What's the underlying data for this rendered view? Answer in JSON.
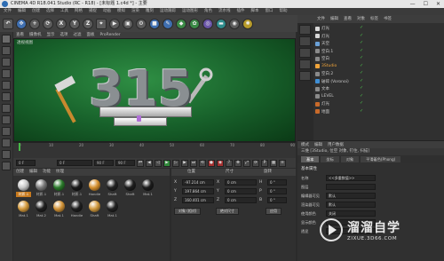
{
  "window": {
    "title": "CINEMA 4D R18.041 Studio (RC - R18) - [未标题 1.c4d *] - 主要"
  },
  "menubar": {
    "items": [
      "文件",
      "编辑",
      "创建",
      "选择",
      "工具",
      "网格",
      "捕捉",
      "动画",
      "模拟",
      "渲染",
      "雕刻",
      "运动跟踪",
      "运动图形",
      "角色",
      "流水线",
      "插件",
      "脚本",
      "窗口",
      "帮助"
    ]
  },
  "toolbar": {
    "buttons": [
      "undo-icon",
      "move-icon",
      "scale-icon",
      "rotate-icon",
      "x-axis",
      "y-axis",
      "z-axis",
      "coordinate-icon",
      "render-view-icon",
      "render-icon",
      "render-settings-icon",
      "cube-icon",
      "pen-icon",
      "subdivision-icon",
      "array-icon",
      "deformer-icon",
      "floor-icon",
      "camera-icon",
      "light-icon"
    ],
    "axis_labels": [
      "X",
      "Y",
      "Z"
    ]
  },
  "viewport": {
    "menu": [
      "查看",
      "摄像机",
      "显示",
      "选项",
      "过滤",
      "面板",
      "ProRender"
    ],
    "label": "透视视图",
    "numerals": "315"
  },
  "timeline": {
    "ticks": [
      "0",
      "10",
      "20",
      "30",
      "40",
      "50",
      "60",
      "70",
      "80",
      "90"
    ],
    "current_frame": "0 F",
    "start_frame": "0 F",
    "end_frame": "90 F",
    "end_frame_2": "90 F"
  },
  "materials": {
    "menu": [
      "创建",
      "编辑",
      "功能",
      "纹理"
    ],
    "items": [
      {
        "label": "材质.1",
        "color": "#c8c8c8",
        "selected": true
      },
      {
        "label": "材质.1",
        "color": "#7a7a7a",
        "selected": false
      },
      {
        "label": "材质.1",
        "color": "#2a7a2a",
        "selected": false
      },
      {
        "label": "材质.1",
        "color": "#1a1a1a",
        "selected": false
      },
      {
        "label": "Handle",
        "color": "#d6902e",
        "selected": false
      },
      {
        "label": "Shaft",
        "color": "#222222",
        "selected": false
      },
      {
        "label": "Shaft",
        "color": "#1e1e1e",
        "selected": false
      },
      {
        "label": "Mat.1",
        "color": "#1c1c1c",
        "selected": false
      },
      {
        "label": "Mat.1",
        "color": "#d49a3c",
        "selected": false
      },
      {
        "label": "Mat.2",
        "color": "#202020",
        "selected": false
      },
      {
        "label": "Mat.1",
        "color": "#d19236",
        "selected": false
      },
      {
        "label": "Handle",
        "color": "#1f1f1f",
        "selected": false
      },
      {
        "label": "Shaft",
        "color": "#d19a3e",
        "selected": false
      },
      {
        "label": "Mat.1",
        "color": "#222222",
        "selected": false
      }
    ]
  },
  "coordinates": {
    "headers": [
      "位置",
      "尺寸",
      "旋转"
    ],
    "rows": [
      {
        "axis": "X",
        "pos": "-97.214 cm",
        "size": "0 cm",
        "rot": "0 °",
        "rot_axis": "H"
      },
      {
        "axis": "Y",
        "pos": "197.864 cm",
        "size": "0 cm",
        "rot": "0 °",
        "rot_axis": "P"
      },
      {
        "axis": "Z",
        "pos": "160.401 cm",
        "size": "0 cm",
        "rot": "0 °",
        "rot_axis": "B"
      }
    ],
    "mode": "对象 (相对)",
    "size_mode": "绝对尺寸",
    "apply": "应用"
  },
  "objects": {
    "menu": [
      "文件",
      "编辑",
      "查看",
      "对象",
      "标签",
      "书签"
    ],
    "items": [
      {
        "name": "灯光",
        "color": "#d8d8d8",
        "selected": false
      },
      {
        "name": "灯光",
        "color": "#d8d8d8",
        "selected": false
      },
      {
        "name": "天空",
        "color": "#6aa0d6",
        "selected": false
      },
      {
        "name": "空白.1",
        "color": "#8a8a8a",
        "selected": false
      },
      {
        "name": "空白",
        "color": "#8a8a8a",
        "selected": false
      },
      {
        "name": "3Studio",
        "color": "#f0a43a",
        "selected": true
      },
      {
        "name": "空白.2",
        "color": "#8a8a8a",
        "selected": false
      },
      {
        "name": "破碎 (Voronoi)",
        "color": "#3f8fd6",
        "selected": false
      },
      {
        "name": "文本",
        "color": "#8a8a8a",
        "selected": false
      },
      {
        "name": "LEVEL",
        "color": "#8a8a8a",
        "selected": false
      },
      {
        "name": "灯光",
        "color": "#c86a2a",
        "selected": false
      },
      {
        "name": "地面",
        "color": "#c86a2a",
        "selected": false
      }
    ]
  },
  "attributes": {
    "menu": [
      "模式",
      "编辑",
      "用户数据"
    ],
    "subtitle": "三维 [3Studio, 位空 对象, 钉住, 扫描]",
    "tabs": [
      "基本",
      "坐标",
      "对象",
      "平滑着色(Phong)"
    ],
    "section": "基本属性",
    "rows": [
      {
        "label": "名称",
        "value": "<<多重数值>>"
      },
      {
        "label": "图层",
        "value": ""
      },
      {
        "label": "编辑器可见",
        "value": "默认"
      },
      {
        "label": "渲染器可见",
        "value": "默认"
      },
      {
        "label": "使用颜色",
        "value": "关闭"
      },
      {
        "label": "显示颜色",
        "value": ""
      },
      {
        "label": "透显",
        "value": ""
      }
    ]
  },
  "watermark": {
    "title": "溜溜自学",
    "url": "ZIXUE.3D66.COM"
  }
}
